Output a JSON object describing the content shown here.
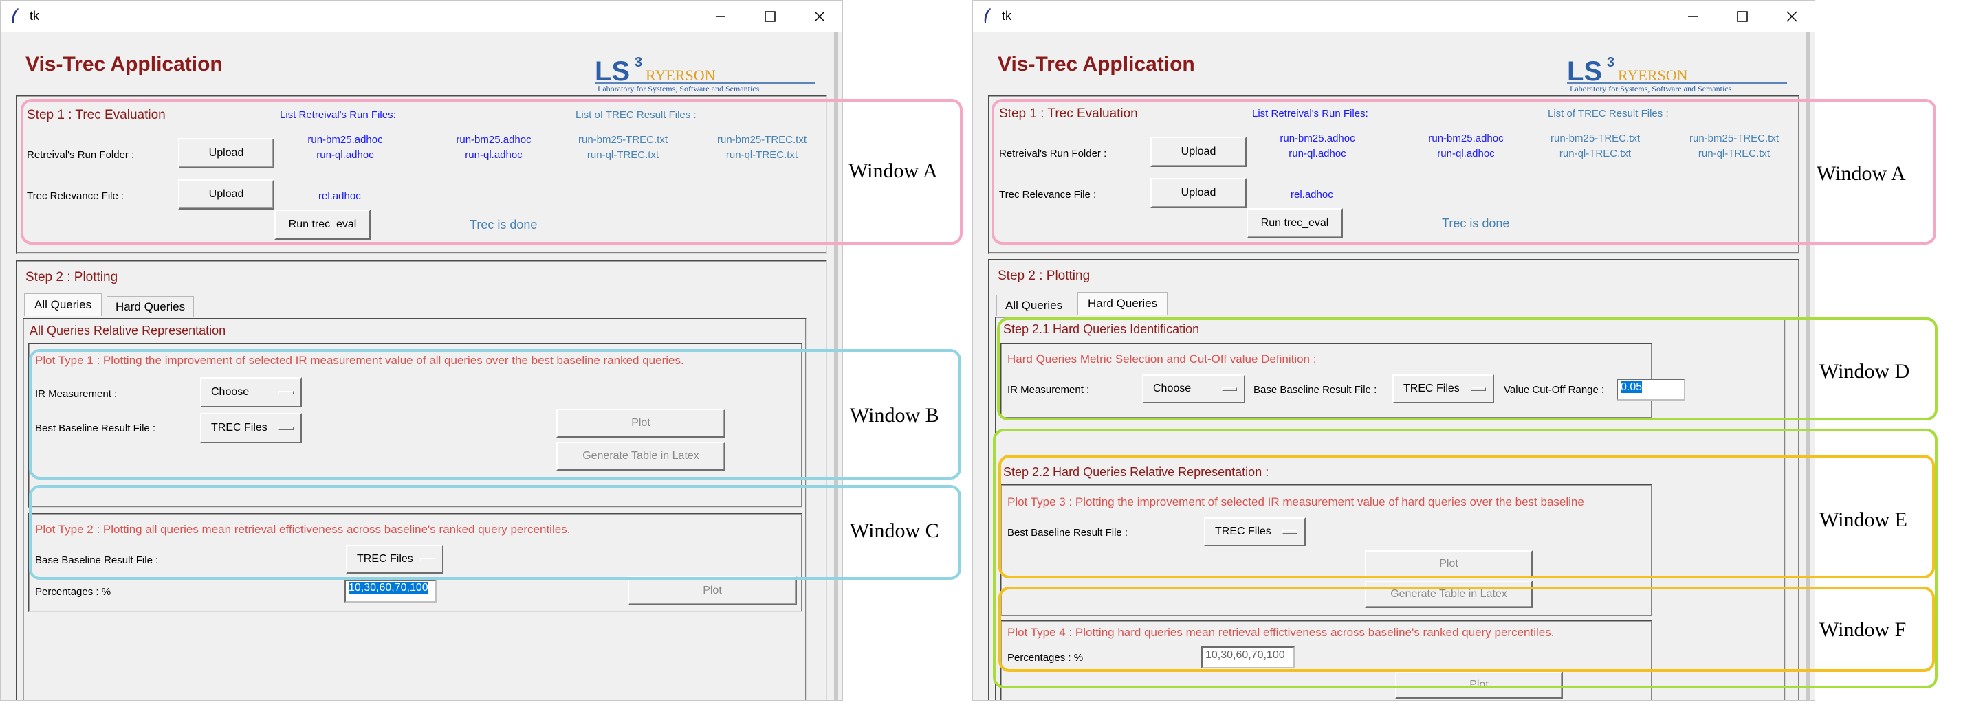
{
  "window_title": "tk",
  "app_title": "Vis-Trec Application",
  "logo": {
    "text": "LS³ RYERSON",
    "subtitle": "Laboratory for Systems, Software and Semantics"
  },
  "step1": {
    "title": "Step 1 : Trec Evaluation",
    "run_files_header": "List Retreival's Run Files:",
    "result_files_header": "List of TREC Result Files :",
    "run_folder_label": "Retreival's Run Folder :",
    "relevance_label": "Trec Relevance File :",
    "upload_label": "Upload",
    "run_button": "Run trec_eval",
    "status": "Trec is done",
    "run_files_col1": [
      "run-bm25.adhoc",
      "run-ql.adhoc"
    ],
    "run_files_col2": [
      "run-bm25.adhoc",
      "run-ql.adhoc"
    ],
    "result_files_col1": [
      "run-bm25-TREC.txt",
      "run-ql-TREC.txt"
    ],
    "result_files_col2": [
      "run-bm25-TREC.txt",
      "run-ql-TREC.txt"
    ],
    "relevance_file": "rel.adhoc"
  },
  "step2": {
    "title": "Step 2 : Plotting",
    "tabs": [
      "All Queries",
      "Hard Queries"
    ]
  },
  "left": {
    "section_title": "All Queries Relative Representation",
    "plot1_title": "Plot Type 1 :  Plotting the improvement of selected IR measurement value of all queries over the best baseline ranked queries.",
    "ir_label": "IR Measurement :",
    "ir_value": "Choose",
    "best_baseline_label": "Best Baseline Result File :",
    "trec_files": "TREC Files",
    "plot_button": "Plot",
    "latex_button": "Generate Table in Latex",
    "plot2_title": "Plot Type 2 :  Plotting all queries mean retrieval effictiveness across baseline's ranked query percentiles.",
    "base_baseline_label": "Base Baseline Result File :",
    "percentages_label": "Percentages : %",
    "percentages_value": "10,30,60,70,100"
  },
  "right": {
    "step21_title": "Step 2.1 Hard Queries Identification",
    "metric_title": "Hard Queries Metric Selection and Cut-Off value Definition :",
    "ir_label": "IR Measurement :",
    "ir_value": "Choose",
    "base_baseline_label": "Base Baseline Result File :",
    "trec_files": "TREC Files",
    "cutoff_label": "Value Cut-Off Range :",
    "cutoff_value": "0.05",
    "step22_title": "Step 2.2 Hard Queries Relative Representation :",
    "plot3_title": "Plot Type 3 :  Plotting the improvement of selected IR measurement value of hard queries over the best baseline",
    "best_baseline_label": "Best Baseline Result File :",
    "plot_button": "Plot",
    "latex_button": "Generate Table in Latex",
    "plot4_title": "Plot Type 4 :  Plotting hard queries mean retrieval effictiveness across baseline's ranked query percentiles.",
    "percentages_label": "Percentages : %",
    "percentages_value": "10,30,60,70,100"
  },
  "annotations": {
    "a": "Window A",
    "b": "Window B",
    "c": "Window C",
    "d": "Window D",
    "e": "Window E",
    "f": "Window F"
  },
  "colors": {
    "title": "#8b1a1a",
    "section": "#d9534f",
    "blue": "#1a1aff",
    "steel": "#4682b4",
    "pink": "#f4a8c4",
    "cyan": "#90d4e4",
    "green": "#a8dc3c",
    "gold": "#f4c020"
  }
}
